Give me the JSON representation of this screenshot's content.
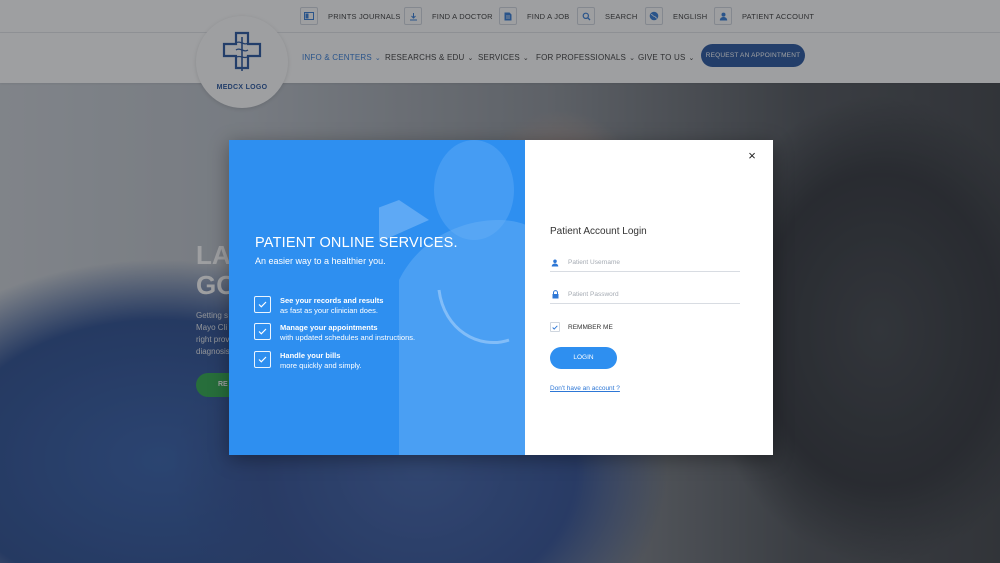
{
  "utility_bar": [
    {
      "label": "PRINTS JOURNALS",
      "icon": "journal-icon"
    },
    {
      "label": "FIND A DOCTOR",
      "icon": "doctor-icon"
    },
    {
      "label": "FIND A JOB",
      "icon": "document-icon"
    },
    {
      "label": "SEARCH",
      "icon": "search-icon"
    },
    {
      "label": "ENGLISH",
      "icon": "globe-icon"
    },
    {
      "label": "PATIENT ACCOUNT",
      "icon": "user-icon"
    }
  ],
  "logo": {
    "text": "MEDCX LOGO"
  },
  "nav": [
    {
      "label": "INFO & CENTERS"
    },
    {
      "label": "RESEARCHS & EDU"
    },
    {
      "label": "SERVICES"
    },
    {
      "label": "FOR PROFESSIONALS"
    },
    {
      "label": "GIVE TO US"
    }
  ],
  "cta": {
    "label": "REQUEST AN APPOINTMENT"
  },
  "hero": {
    "headline_line1": "LA",
    "headline_line2": "GO",
    "blurb": "Getting s Mayo Cli right prov diagnosis",
    "button": "RE"
  },
  "modal": {
    "promo_title": "PATIENT ONLINE SERVICES.",
    "promo_subtitle": "An easier way to a healthier you.",
    "features": [
      {
        "title": "See your records and results",
        "desc": "as fast as your clinician does."
      },
      {
        "title": "Manage your appointments",
        "desc": "with updated schedules and instructions."
      },
      {
        "title": "Handle your bills",
        "desc": "more quickly and simply."
      }
    ],
    "close_label": "×",
    "login_title": "Patient Account Login",
    "username_placeholder": "Patient Username",
    "password_placeholder": "Patient Password",
    "remember_label": "REMMBER ME",
    "login_button": "LOGIN",
    "signup_link": "Don't have an account ?"
  },
  "colors": {
    "primary": "#2e8ff0",
    "dark_blue": "#1f4f9b",
    "accent_text": "#2d77d6"
  }
}
